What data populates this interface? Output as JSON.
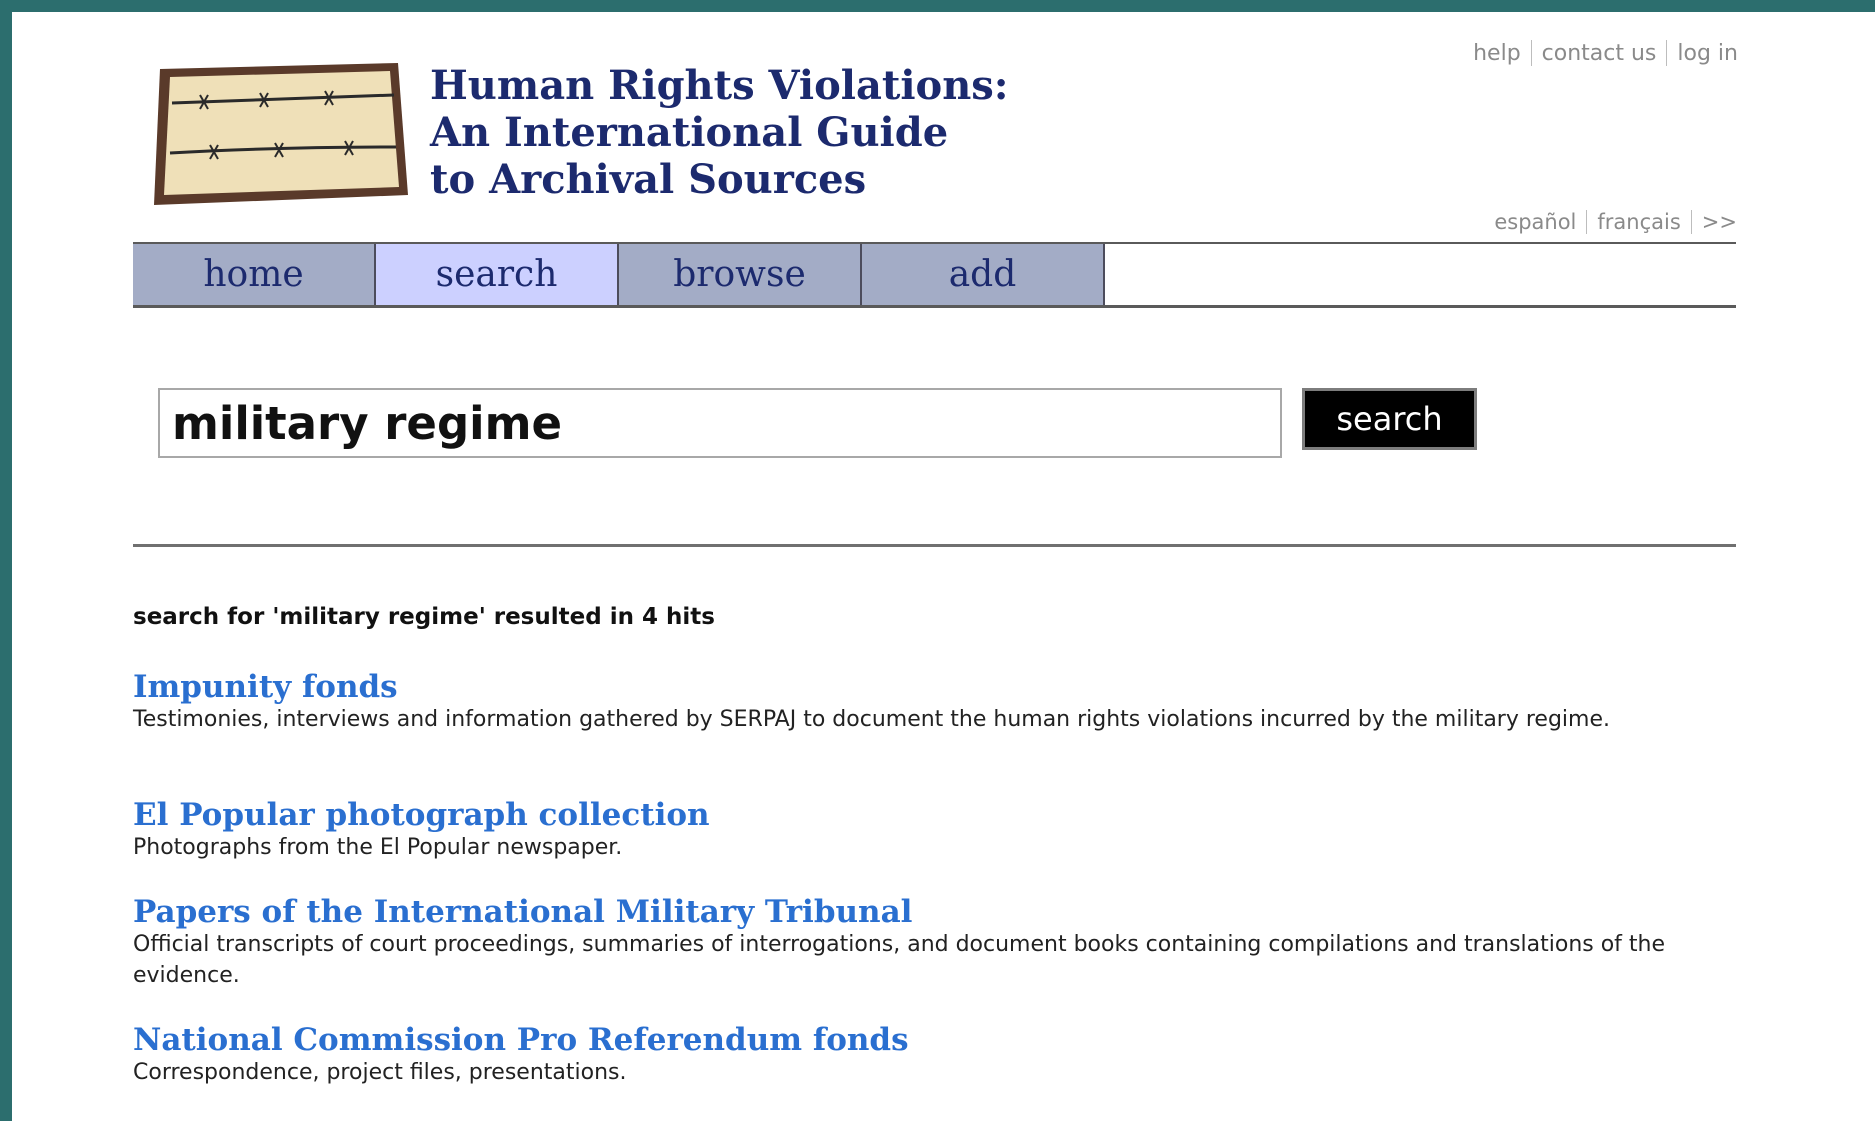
{
  "header": {
    "title_lines": [
      "Human Rights Violations:",
      "An International Guide",
      "to Archival Sources"
    ],
    "util_links": [
      "help",
      "contact us",
      "log in"
    ],
    "lang_links": [
      "español",
      "français",
      ">>"
    ]
  },
  "nav": {
    "tabs": [
      {
        "label": "home",
        "active": false
      },
      {
        "label": "search",
        "active": true
      },
      {
        "label": "browse",
        "active": false
      },
      {
        "label": "add",
        "active": false
      }
    ]
  },
  "search": {
    "query": "military regime",
    "button_label": "search"
  },
  "results": {
    "summary": "search for 'military regime' resulted in 4 hits",
    "items": [
      {
        "title": "Impunity fonds",
        "description": "Testimonies, interviews and information gathered by SERPAJ to document the human rights violations incurred by the military regime."
      },
      {
        "title": "El Popular photograph collection",
        "description": "Photographs from the El Popular newspaper."
      },
      {
        "title": "Papers of the International Military Tribunal",
        "description": "Official transcripts of court proceedings, summaries of interrogations, and document books containing compilations and translations of the evidence."
      },
      {
        "title": "National Commission Pro Referendum fonds",
        "description": "Correspondence, project files, presentations."
      }
    ]
  },
  "colors": {
    "frame": "#2c6e6e",
    "title": "#1c2a6e",
    "nav_tab": "#a3acc6",
    "nav_tab_active": "#ccd0ff",
    "link": "#2a6fd0"
  }
}
